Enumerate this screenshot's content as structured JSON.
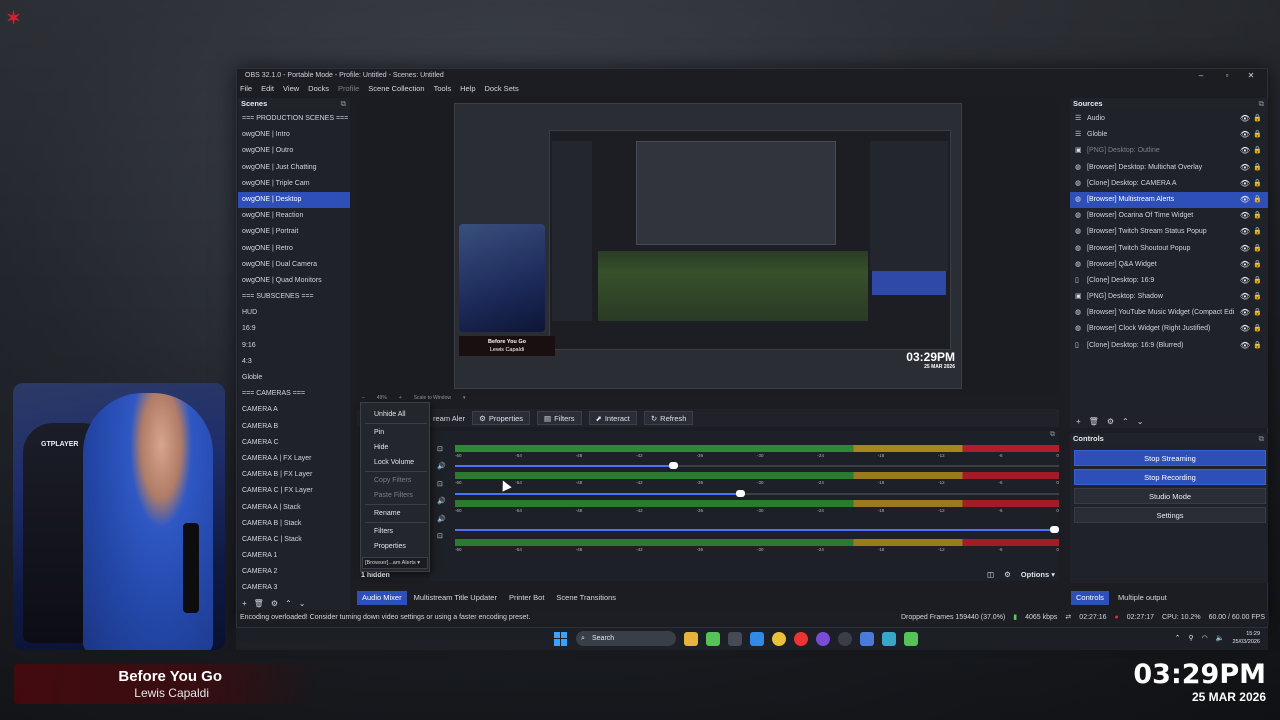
{
  "window": {
    "title": "OBS 32.1.0 - Portable Mode - Profile: Untitled - Scenes: Untitled"
  },
  "menu": [
    {
      "label": "File"
    },
    {
      "label": "Edit"
    },
    {
      "label": "View"
    },
    {
      "label": "Docks"
    },
    {
      "label": "Profile",
      "disabled": true
    },
    {
      "label": "Scene Collection"
    },
    {
      "label": "Tools"
    },
    {
      "label": "Help"
    },
    {
      "label": "Dock Sets"
    }
  ],
  "scenes": {
    "title": "Scenes",
    "items": [
      "=== PRODUCTION SCENES ===",
      "owgONE | Intro",
      "owgONE | Outro",
      "owgONE | Just Chatting",
      "owgONE | Triple Cam",
      "owgONE | Desktop",
      "owgONE | Reaction",
      "owgONE | Portrait",
      "owgONE | Retro",
      "owgONE | Dual Camera",
      "owgONE | Quad Monitors",
      "=== SUBSCENES ===",
      "HUD",
      "16:9",
      "9:16",
      "4:3",
      "Globle",
      "=== CAMERAS ===",
      "CAMERA A",
      "CAMERA B",
      "CAMERA C",
      "CAMERA A | FX Layer",
      "CAMERA B | FX Layer",
      "CAMERA C | FX Layer",
      "CAMERA A | Stack",
      "CAMERA B | Stack",
      "CAMERA C | Stack",
      "CAMERA 1",
      "CAMERA 2",
      "CAMERA 3"
    ],
    "selected_index": 5
  },
  "preview": {
    "zoom": "49%",
    "scale_label": "Scale to Window",
    "song_title": "Before You Go",
    "song_artist": "Lewis Capaldi",
    "clock": "03:29PM",
    "date": "25 MAR 2026"
  },
  "context_bar": {
    "source_name": "ream Aler",
    "properties": "Properties",
    "filters": "Filters",
    "interact": "Interact",
    "refresh": "Refresh"
  },
  "context_menu": {
    "unhide_all": "Unhide All",
    "pin": "Pin",
    "hide": "Hide",
    "lock_volume": "Lock Volume",
    "copy_filters": "Copy Filters",
    "paste_filters": "Paste Filters",
    "rename": "Rename",
    "filters": "Filters",
    "properties": "Properties",
    "combo": "[Browser]...am Alerts"
  },
  "mixer": {
    "ticks": [
      "-60",
      "-54",
      "-48",
      "-42",
      "-36",
      "-30",
      "-24",
      "-18",
      "-12",
      "-6",
      "0"
    ],
    "channels": [
      {
        "volume": 0.37
      },
      {
        "volume": 0.48
      },
      {
        "volume": 1.0
      }
    ],
    "hidden_count": "1 hidden",
    "options": "Options"
  },
  "bottom_tabs": [
    {
      "label": "Audio Mixer",
      "active": true
    },
    {
      "label": "Multistream Title Updater"
    },
    {
      "label": "Printer Bot"
    },
    {
      "label": "Scene Transitions"
    }
  ],
  "sources": {
    "title": "Sources",
    "items": [
      {
        "label": "Audio",
        "icon": "list-icon"
      },
      {
        "label": "Globle",
        "icon": "list-icon"
      },
      {
        "label": "[PNG] Desktop: Outline",
        "icon": "image-icon",
        "dim": true
      },
      {
        "label": "[Browser] Desktop: Multichat Overlay",
        "icon": "globe-icon"
      },
      {
        "label": "[Clone] Desktop: CAMERA A",
        "icon": "globe-icon"
      },
      {
        "label": "[Browser] Multistream Alerts",
        "icon": "globe-icon",
        "selected": true
      },
      {
        "label": "[Browser] Ocarina Of Time Widget",
        "icon": "globe-icon"
      },
      {
        "label": "[Browser] Twitch Stream Status Popup",
        "icon": "globe-icon"
      },
      {
        "label": "[Browser] Twitch Shoutout Popup",
        "icon": "globe-icon"
      },
      {
        "label": "[Browser] Q&A Widget",
        "icon": "globe-icon"
      },
      {
        "label": "[Clone] Desktop: 16:9",
        "icon": "file-icon"
      },
      {
        "label": "[PNG] Desktop: Shadow",
        "icon": "image-icon"
      },
      {
        "label": "[Browser] YouTube Music Widget (Compact Edi",
        "icon": "globe-icon"
      },
      {
        "label": "[Browser] Clock Widget (Right Justified)",
        "icon": "globe-icon"
      },
      {
        "label": "[Clone] Desktop: 16:9 (Blurred)",
        "icon": "file-icon"
      }
    ]
  },
  "controls": {
    "title": "Controls",
    "stop_streaming": "Stop Streaming",
    "stop_recording": "Stop Recording",
    "studio_mode": "Studio Mode",
    "settings": "Settings"
  },
  "right_tabs": [
    {
      "label": "Controls",
      "active": true
    },
    {
      "label": "Multiple output"
    }
  ],
  "status": {
    "message": "Encoding overloaded! Consider turning down video settings or using a faster encoding preset.",
    "dropped_frames": "Dropped Frames 159440 (37.0%)",
    "bitrate": "4065 kbps",
    "stream_time": "02:27:16",
    "record_time": "02:27:17",
    "cpu": "CPU: 10.2%",
    "fps": "60.00 / 60.00 FPS"
  },
  "taskbar": {
    "search": "Search",
    "time": "15:29",
    "date": "25/03/2026"
  },
  "overlay": {
    "song_title": "Before You Go",
    "song_artist": "Lewis Capaldi",
    "time": "03:29PM",
    "date": "25 MAR 2026",
    "chair_brand": "GTPLAYER"
  },
  "colors": {
    "accent": "#2f4fb8",
    "meter_green": "#2d8a32",
    "meter_yellow": "#a9851f",
    "meter_red": "#b11e2a"
  }
}
